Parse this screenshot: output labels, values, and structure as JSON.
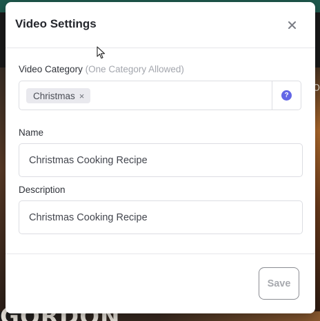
{
  "modal": {
    "title": "Video Settings"
  },
  "category": {
    "label": "Video Category",
    "hint": "(One Category Allowed)",
    "selected_tag": "Christmas",
    "tag_remove_glyph": "×",
    "help_glyph": "?"
  },
  "name": {
    "label": "Name",
    "value": "Christmas Cooking Recipe"
  },
  "description": {
    "label": "Description",
    "value": "Christmas Cooking Recipe"
  },
  "footer": {
    "save_label": "Save"
  },
  "background": {
    "bottom_text": "GORDON",
    "right_text": "O"
  },
  "colors": {
    "accent": "#6366e6",
    "save_text_disabled": "#a7a9ae"
  },
  "icons": {
    "close": "close-icon",
    "help": "question-circle-icon",
    "cursor": "mouse-pointer-icon"
  }
}
